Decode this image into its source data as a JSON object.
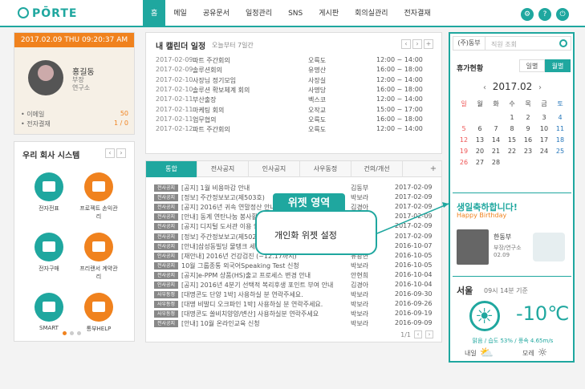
{
  "header": {
    "logo": "PŌRTE",
    "nav": [
      "홈",
      "메일",
      "공유문서",
      "일정관리",
      "SNS",
      "게시판",
      "회의실관리",
      "전자결재"
    ],
    "active_index": 0,
    "tools": [
      "설정",
      "?",
      "⏻"
    ]
  },
  "profile": {
    "date": "2017.02.09 THU 09:20:37 AM",
    "name": "홍길동",
    "rank": "부장",
    "dept": "연구소",
    "mail_label": "이메일",
    "mail_count": "50",
    "approval_label": "전자결재",
    "approval_count": "1 / 0"
  },
  "system": {
    "title": "우리 회사 시스템",
    "items": [
      "전자전표",
      "프로젝트 손익관리",
      "전자구매",
      "프리랜서 계약관리",
      "SMART",
      "통부HELP"
    ],
    "icon_colors": [
      "#1fa79f",
      "#f0821e",
      "#1fa79f",
      "#f0821e",
      "#1fa79f",
      "#f0821e"
    ]
  },
  "calendar": {
    "title": "내 캘린더 일정",
    "subtitle": "오늘부터 7일간",
    "rows": [
      {
        "date": "2017-02-09",
        "title": "파트 주간회의",
        "place": "오륙도",
        "time": "12:00 ~ 14:00"
      },
      {
        "date": "2017-02-09",
        "title": "솔루션회의",
        "place": "유명산",
        "time": "16:00 ~ 18:00"
      },
      {
        "date": "2017-02-10",
        "title": "사장님 정기모임",
        "place": "사장실",
        "time": "12:00 ~ 14:00"
      },
      {
        "date": "2017-02-10",
        "title": "솔루션 확보체계 회의",
        "place": "사명당",
        "time": "16:00 ~ 18:00"
      },
      {
        "date": "2017-02-11",
        "title": "부산출장",
        "place": "벡스코",
        "time": "12:00 ~ 14:00"
      },
      {
        "date": "2017-02-11",
        "title": "마케팅 회의",
        "place": "오작교",
        "time": "15:00 ~ 17:00"
      },
      {
        "date": "2017-02-11",
        "title": "업무협의",
        "place": "오륙도",
        "time": "16:00 ~ 18:00"
      },
      {
        "date": "2017-02-12",
        "title": "파트 주간회의",
        "place": "오륙도",
        "time": "12:00 ~ 14:00"
      }
    ]
  },
  "board": {
    "tabs": [
      "통합",
      "전사공지",
      "인사공지",
      "사우동정",
      "건의/개선"
    ],
    "active_index": 0,
    "rows": [
      {
        "badge": "전사공지",
        "title": "[공지] 1월 비용마감 안내",
        "writer": "김동부",
        "date": "2017-02-09"
      },
      {
        "badge": "전사공지",
        "title": "[정보] 주간정보보고(제503호)",
        "writer": "박보라",
        "date": "2017-02-09"
      },
      {
        "badge": "전사공지",
        "title": "[공지] 2016년 귀속 연말정산 안내",
        "writer": "김경아",
        "date": "2017-02-09"
      },
      {
        "badge": "전사공지",
        "title": "[안내] 동계 연탄나눔 봉사활동",
        "writer": "박보라",
        "date": "2017-02-09"
      },
      {
        "badge": "전사공지",
        "title": "[공지] 디지털 도서관 이용 안내",
        "writer": "박보라",
        "date": "2017-02-09"
      },
      {
        "badge": "전사공지",
        "title": "[정보] 주간정보보고(제502호)",
        "writer": "박보라",
        "date": "2017-02-09"
      },
      {
        "badge": "전사공지",
        "title": "[안내]삼성동빌딩 물탱크 세척",
        "writer": "박보라",
        "date": "2016-10-07"
      },
      {
        "badge": "인사공지",
        "title": "[재안내] 2016년 건강검진 (~12.17까지)",
        "writer": "유광현",
        "date": "2016-10-05"
      },
      {
        "badge": "전사공지",
        "title": "10월 그룹종통 외국어Speaking Test 신청",
        "writer": "박보라",
        "date": "2016-10-05"
      },
      {
        "badge": "전사공지",
        "title": "[공지]e-PPM 상품(HS)출고 프로세스 변경 안내",
        "writer": "안현희",
        "date": "2016-10-04"
      },
      {
        "badge": "인사공지",
        "title": "[공지] 2016년 4분기 선택적 복리후생 포인트 부여 안내",
        "writer": "김경아",
        "date": "2016-10-04"
      },
      {
        "badge": "사우동정",
        "title": "[대명콘도 단양 1박] 사용하실 분 연락주세요.",
        "writer": "박보라",
        "date": "2016-09-30"
      },
      {
        "badge": "사우동정",
        "title": "[대명 비발디 오크파인 1박] 사용하실 분 연락주세요.",
        "writer": "박보라",
        "date": "2016-09-26"
      },
      {
        "badge": "사우동정",
        "title": "[대명콘도 쏠비치양양/변산] 사용하실분 연락주세요",
        "writer": "박보라",
        "date": "2016-09-19"
      },
      {
        "badge": "전사공지",
        "title": "[안내] 10월 온라인교육 신청",
        "writer": "박보라",
        "date": "2016-09-09"
      }
    ],
    "pager": "1/1"
  },
  "overlay": {
    "title": "위젯 영역",
    "bubble": "개인화 위젯 설정"
  },
  "right": {
    "search_select": "(주)동부",
    "search_placeholder": "직원 조회",
    "vacation_title": "휴가현황",
    "vacation_tabs": [
      "일별",
      "월별"
    ],
    "month": "2017.02",
    "weekdays": [
      "일",
      "월",
      "화",
      "수",
      "목",
      "금",
      "토"
    ],
    "weeks": [
      [
        "",
        "",
        "",
        "1",
        "2",
        "3",
        "4"
      ],
      [
        "5",
        "6",
        "7",
        "8",
        "9",
        "10",
        "11"
      ],
      [
        "12",
        "13",
        "14",
        "15",
        "16",
        "17",
        "18"
      ],
      [
        "19",
        "20",
        "21",
        "22",
        "23",
        "24",
        "25"
      ],
      [
        "26",
        "27",
        "28",
        "",
        "",
        "",
        ""
      ]
    ],
    "bday_title": "생일축하합니다!",
    "bday_en": "Happy Birthday",
    "bday_name": "한동부",
    "bday_dept": "부장/연구소",
    "bday_date": "02.09",
    "city": "서울",
    "time": "09시 14분 기준",
    "temp": "-10℃",
    "weather_desc": "맑음 / 습도 53% / 풍속 4.65m/s",
    "tomorrow": "내일",
    "day_after": "모레"
  }
}
